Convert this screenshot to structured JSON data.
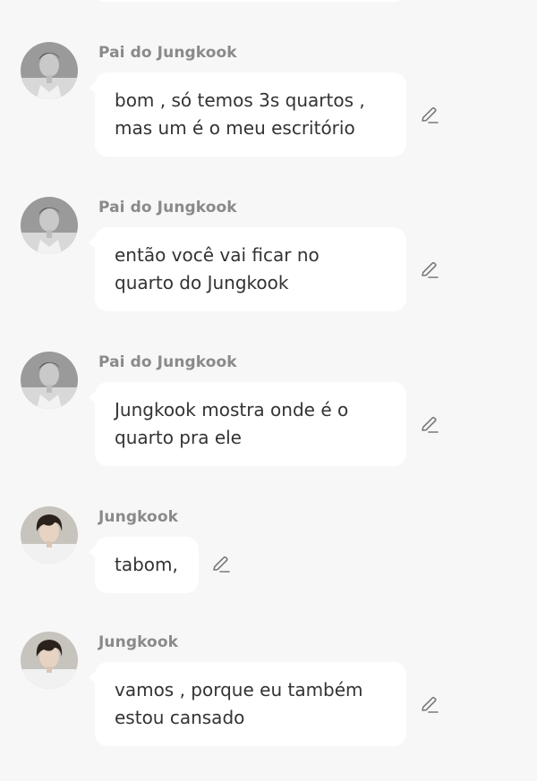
{
  "messages": [
    {
      "sender": "Pai do Jungkook",
      "avatar_icon": "father-portrait-avatar",
      "lines": [
        "bom , só temos 3s quartos ,",
        "mas um é o meu escritório"
      ]
    },
    {
      "sender": "Pai do Jungkook",
      "avatar_icon": "father-portrait-avatar",
      "lines": [
        "então você vai ficar no",
        "quarto do Jungkook"
      ]
    },
    {
      "sender": "Pai do Jungkook",
      "avatar_icon": "father-portrait-avatar",
      "lines": [
        "Jungkook mostra onde é o",
        "quarto pra ele"
      ]
    },
    {
      "sender": "Jungkook",
      "avatar_icon": "jungkook-portrait-avatar",
      "lines": [
        "tabom,"
      ]
    },
    {
      "sender": "Jungkook",
      "avatar_icon": "jungkook-portrait-avatar",
      "lines": [
        "vamos , porque eu também",
        "estou cansado"
      ]
    }
  ],
  "edit_icon": "pencil-edit-icon",
  "colors": {
    "background": "#f7f7f7",
    "bubble": "#ffffff",
    "text": "#333333",
    "sender": "#8a8a8a",
    "icon": "#7a7a7a"
  }
}
